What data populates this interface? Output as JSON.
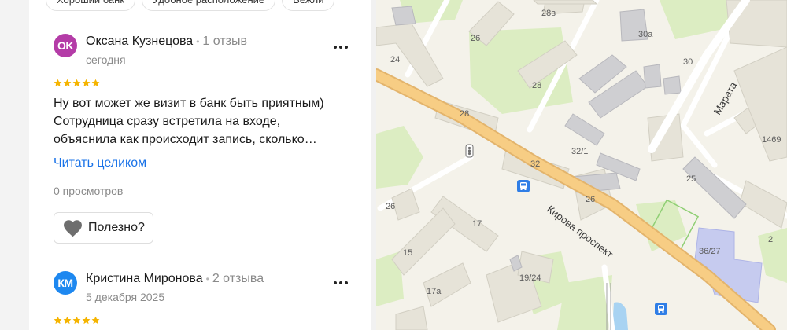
{
  "filter_tags": [
    "Хороший банк",
    "Удобное расположение",
    "Вежли"
  ],
  "reviews": [
    {
      "avatar_initials": "OK",
      "avatar_color": "#b43ca7",
      "author": "Оксана Кузнецова",
      "review_count": "1 отзыв",
      "date": "сегодня",
      "rating": 5,
      "text_lines": [
        "Ну вот может же визит в банк быть приятным)",
        "Сотрудница сразу встретила на входе,",
        "объяснила как происходит запись, сколько…"
      ],
      "read_more": "Читать целиком",
      "views": "0 просмотров",
      "useful_label": "Полезно?"
    },
    {
      "avatar_initials": "КМ",
      "avatar_color": "#1e88f0",
      "author": "Кристина Миронова",
      "review_count": "2 отзыва",
      "date": "5 декабря 2025",
      "rating": 5
    }
  ],
  "colors": {
    "star": "#f5b400",
    "link": "#1a73e8",
    "map_background": "#f4f2ea",
    "main_road": "#f7cd84",
    "building": "#e6e3d8",
    "building_gray": "#cfcfcf",
    "park": "#d9edbc",
    "school": "#c6cbef"
  },
  "map": {
    "street_main": "Кирова проспект",
    "street_side": "Марата",
    "house_numbers": [
      "28в",
      "26",
      "24",
      "30а",
      "30",
      "28",
      "32/1",
      "28",
      "1469",
      "32",
      "25",
      "26",
      "26",
      "17",
      "15",
      "2",
      "36/27",
      "19/24",
      "17а"
    ],
    "icons": [
      "traffic-light-icon",
      "bus-stop-icon",
      "bus-stop-icon"
    ]
  }
}
